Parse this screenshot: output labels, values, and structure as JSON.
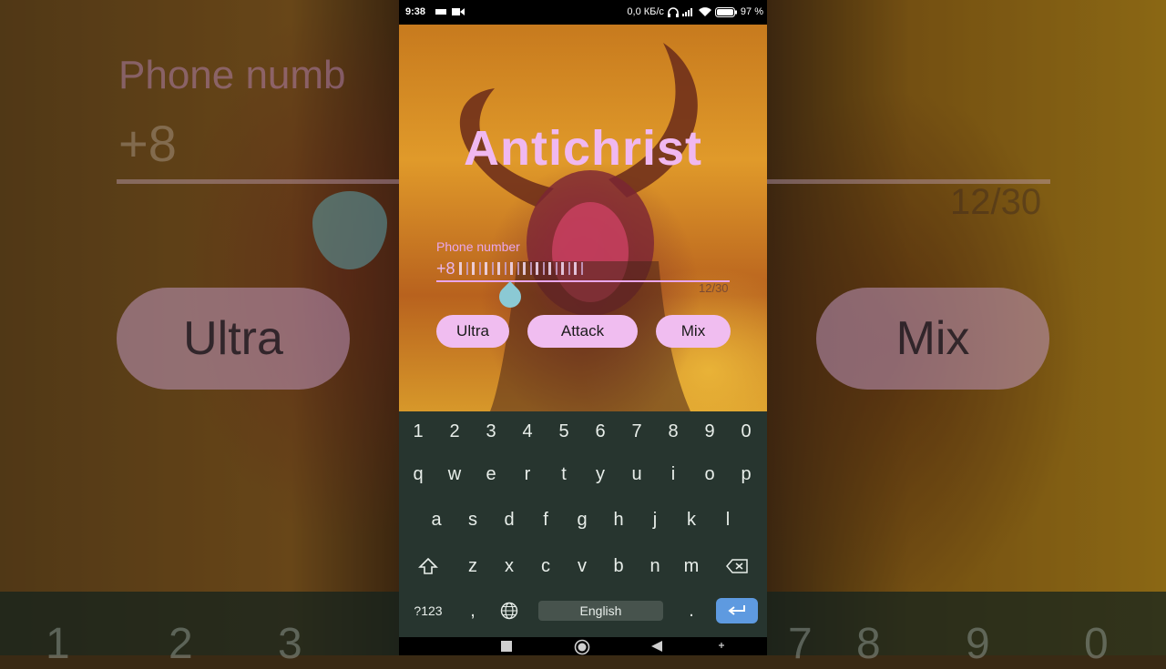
{
  "status_bar": {
    "time": "9:38",
    "speed": "0,0 КБ/с",
    "battery": "97 %"
  },
  "app": {
    "title": "Antichrist",
    "phone_label": "Phone number",
    "phone_value_prefix": "+8",
    "counter": "12/30",
    "buttons": {
      "ultra": "Ultra",
      "attack": "Attack",
      "mix": "Mix"
    }
  },
  "backdrop": {
    "phone_label": "Phone numb",
    "phone_value_prefix": "+8",
    "counter": "12/30",
    "ultra": "Ultra",
    "mix": "Mix",
    "digits": [
      "1",
      "2",
      "3",
      "7",
      "8",
      "9",
      "0"
    ]
  },
  "keyboard": {
    "row_numbers": [
      "1",
      "2",
      "3",
      "4",
      "5",
      "6",
      "7",
      "8",
      "9",
      "0"
    ],
    "row_1": [
      "q",
      "w",
      "e",
      "r",
      "t",
      "y",
      "u",
      "i",
      "o",
      "p"
    ],
    "row_2": [
      "a",
      "s",
      "d",
      "f",
      "g",
      "h",
      "j",
      "k",
      "l"
    ],
    "row_3": [
      "z",
      "x",
      "c",
      "v",
      "b",
      "n",
      "m"
    ],
    "symbols_label": "?123",
    "comma": ",",
    "space_label": "English",
    "period": "."
  },
  "icons": {
    "shift": "shift-icon",
    "backspace": "backspace-icon",
    "globe": "globe-icon",
    "enter": "enter-icon"
  },
  "colors": {
    "accent_pink": "#f0bdf0",
    "keyboard_bg": "#27352f",
    "enter_blue": "#5e9ae0"
  }
}
